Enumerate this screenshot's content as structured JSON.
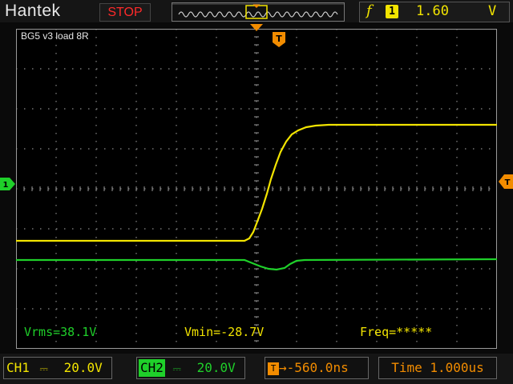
{
  "header": {
    "brand": "Hantek",
    "run_status": "STOP",
    "trigger": {
      "slope_symbol": "f",
      "source_label": "1",
      "level": "1.60",
      "unit": "V"
    }
  },
  "annotation": "BG5 v3 load 8R",
  "markers": {
    "trigger_position": "T",
    "ch1_ground": "1",
    "trigger_level": "T"
  },
  "measurements": {
    "vrms": "Vrms=38.1V",
    "vmin": "Vmin=-28.7V",
    "freq": "Freq=*****"
  },
  "footer": {
    "ch1_label": "CH1",
    "ch1_scale": "20.0V",
    "ch2_label": "CH2",
    "ch2_scale": "20.0V",
    "trigger_offset": "-560.0ns",
    "timebase": "Time 1.000us"
  },
  "colors": {
    "ch1": "#f2e400",
    "ch2": "#1fd02a",
    "accent": "#f28c00",
    "stop": "#ff2a2a"
  }
}
